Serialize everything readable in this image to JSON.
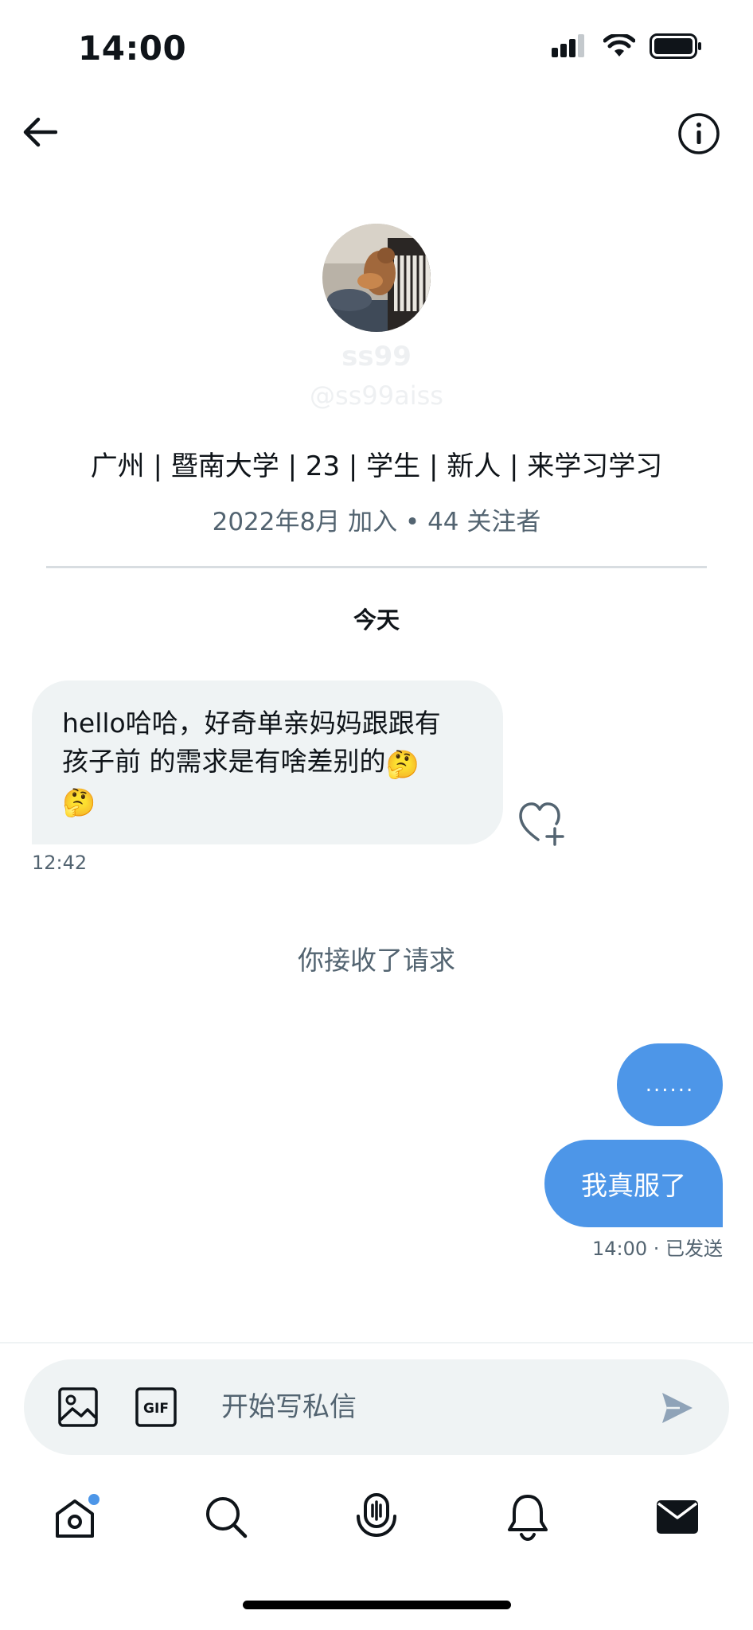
{
  "status_bar": {
    "time": "14:00"
  },
  "profile": {
    "display_name": "ss99",
    "handle": "@ss99aiss",
    "bio": "广州 | 暨南大学 | 23 | 学生 | 新人 | 来学习学习",
    "joined": "2022年8月 加入",
    "separator": " • ",
    "followers": "44 关注者"
  },
  "conversation": {
    "date_label": "今天",
    "received": {
      "text_line1": "hello哈哈，好奇单亲妈妈跟跟有",
      "text_line2": "孩子前 的需求是有啥差别的",
      "emoji": "🤔",
      "time": "12:42"
    },
    "system_note": "你接收了请求",
    "sent": [
      {
        "text": "......"
      },
      {
        "text": "我真服了"
      }
    ],
    "sent_status": "14:00 · 已发送"
  },
  "composer": {
    "placeholder": "开始写私信",
    "gif_label": "GIF"
  },
  "colors": {
    "accent": "#4d96e8",
    "bubble_in": "#eff3f4",
    "secondary_text": "#536471"
  },
  "icons": [
    "back-arrow-icon",
    "info-icon",
    "heart-plus-icon",
    "image-icon",
    "gif-icon",
    "send-icon",
    "home-icon",
    "search-icon",
    "spaces-icon",
    "bell-icon",
    "mail-icon"
  ]
}
